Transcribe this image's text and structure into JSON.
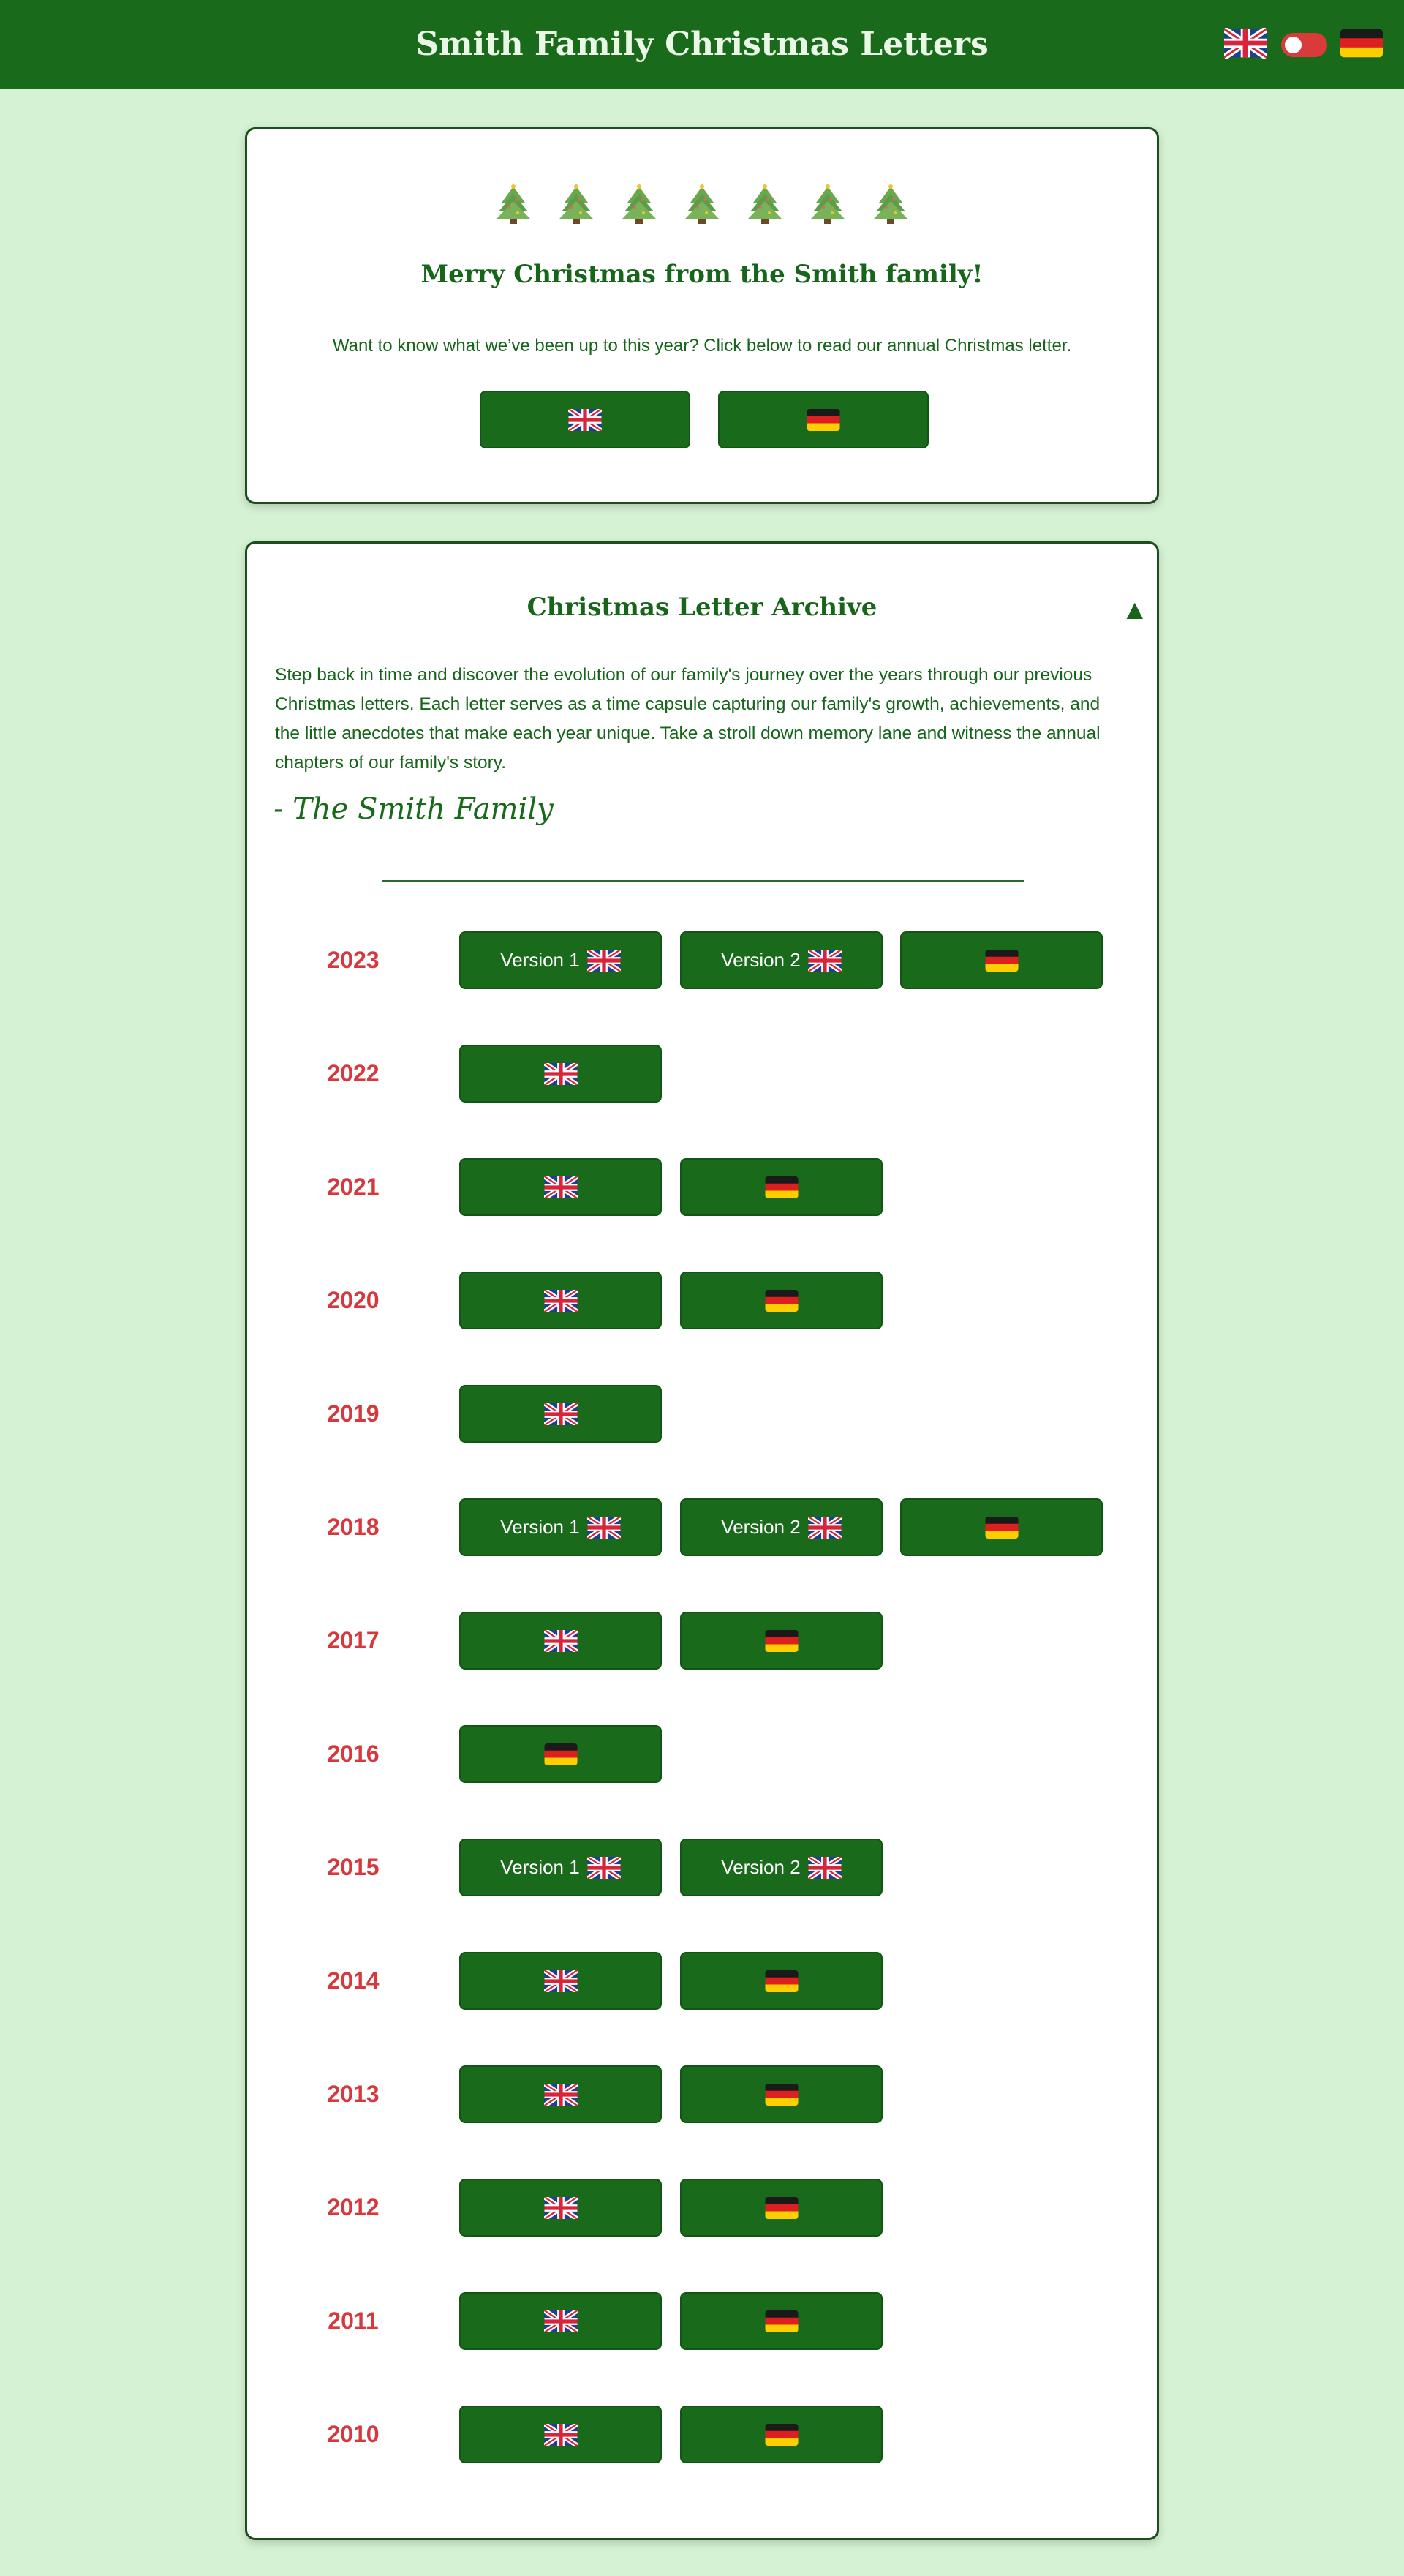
{
  "header": {
    "title": "Smith Family Christmas Letters"
  },
  "hero": {
    "heading": "Merry Christmas from the Smith family!",
    "text": "Want to know what we’ve been up to this year? Click below to read our annual Christmas letter."
  },
  "archive": {
    "heading": "Christmas Letter Archive",
    "toggle_symbol": "▲",
    "intro": "Step back in time and discover the evolution of our family's journey over the years through our previous Christmas letters. Each letter serves as a time capsule capturing our family's growth, achievements, and the little anecdotes that make each year unique. Take a stroll down memory lane and witness the annual chapters of our family's story.",
    "signature": "- The Smith Family",
    "years": [
      {
        "year": "2023",
        "buttons": [
          {
            "label": "Version 1",
            "flag": "uk"
          },
          {
            "label": "Version 2",
            "flag": "uk"
          },
          {
            "label": "",
            "flag": "de"
          }
        ]
      },
      {
        "year": "2022",
        "buttons": [
          {
            "label": "",
            "flag": "uk"
          }
        ]
      },
      {
        "year": "2021",
        "buttons": [
          {
            "label": "",
            "flag": "uk"
          },
          {
            "label": "",
            "flag": "de"
          }
        ]
      },
      {
        "year": "2020",
        "buttons": [
          {
            "label": "",
            "flag": "uk"
          },
          {
            "label": "",
            "flag": "de"
          }
        ]
      },
      {
        "year": "2019",
        "buttons": [
          {
            "label": "",
            "flag": "uk"
          }
        ]
      },
      {
        "year": "2018",
        "buttons": [
          {
            "label": "Version 1",
            "flag": "uk"
          },
          {
            "label": "Version 2",
            "flag": "uk"
          },
          {
            "label": "",
            "flag": "de"
          }
        ]
      },
      {
        "year": "2017",
        "buttons": [
          {
            "label": "",
            "flag": "uk"
          },
          {
            "label": "",
            "flag": "de"
          }
        ]
      },
      {
        "year": "2016",
        "buttons": [
          {
            "label": "",
            "flag": "de"
          }
        ]
      },
      {
        "year": "2015",
        "buttons": [
          {
            "label": "Version 1",
            "flag": "uk"
          },
          {
            "label": "Version 2",
            "flag": "uk"
          }
        ]
      },
      {
        "year": "2014",
        "buttons": [
          {
            "label": "",
            "flag": "uk"
          },
          {
            "label": "",
            "flag": "de"
          }
        ]
      },
      {
        "year": "2013",
        "buttons": [
          {
            "label": "",
            "flag": "uk"
          },
          {
            "label": "",
            "flag": "de"
          }
        ]
      },
      {
        "year": "2012",
        "buttons": [
          {
            "label": "",
            "flag": "uk"
          },
          {
            "label": "",
            "flag": "de"
          }
        ]
      },
      {
        "year": "2011",
        "buttons": [
          {
            "label": "",
            "flag": "uk"
          },
          {
            "label": "",
            "flag": "de"
          }
        ]
      },
      {
        "year": "2010",
        "buttons": [
          {
            "label": "",
            "flag": "uk"
          },
          {
            "label": "",
            "flag": "de"
          }
        ]
      }
    ]
  },
  "colors": {
    "header_bg": "#196a1b",
    "page_bg": "#d5f2d4",
    "year": "#d6393d",
    "toggle": "#d93a3a"
  },
  "icons": {
    "tree": "christmas-tree-icon",
    "uk": "uk-flag-icon",
    "de": "german-flag-icon"
  }
}
